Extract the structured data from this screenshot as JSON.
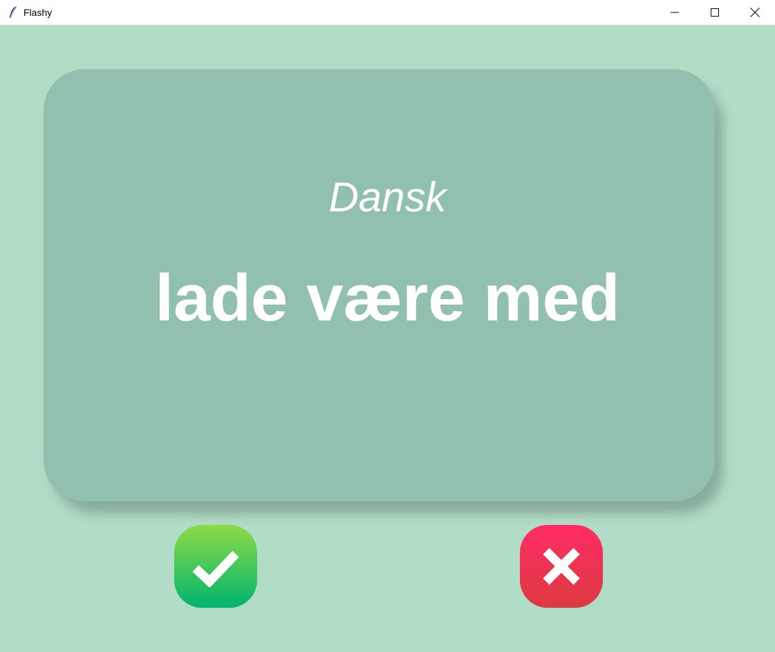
{
  "window": {
    "title": "Flashy",
    "icon": "feather-icon",
    "controls": [
      "minimize-icon",
      "maximize-icon",
      "close-icon"
    ]
  },
  "card": {
    "language": "Dansk",
    "word": "lade være med"
  },
  "buttons": {
    "right": "check-icon",
    "wrong": "cross-icon"
  },
  "colors": {
    "background": "#b1dcc6",
    "card": "#91c1ae",
    "text": "#ffffff",
    "right_button": "#1fc15b",
    "wrong_button": "#f0325a"
  }
}
